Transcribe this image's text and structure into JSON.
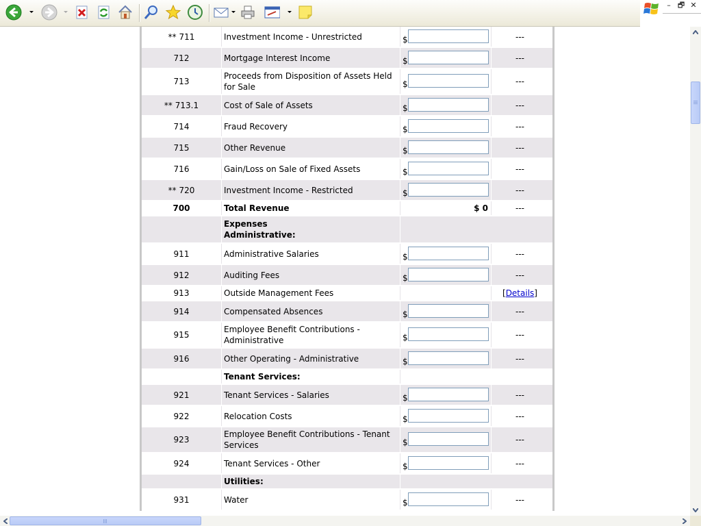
{
  "window": {
    "minimize_glyph": "–",
    "restore_glyph": "🗗",
    "close_glyph": "✕"
  },
  "toolbar": {
    "buttons": [
      {
        "name": "back-icon",
        "has_dropdown": true
      },
      {
        "name": "forward-icon",
        "has_dropdown": true
      },
      {
        "name": "stop-icon"
      },
      {
        "name": "refresh-icon"
      },
      {
        "name": "home-icon"
      },
      {
        "name": "search-icon"
      },
      {
        "name": "favorites-icon"
      },
      {
        "name": "history-icon"
      },
      {
        "name": "mail-icon",
        "has_dropdown": true
      },
      {
        "name": "print-icon"
      },
      {
        "name": "edit-icon",
        "has_dropdown": true
      },
      {
        "name": "note-icon"
      }
    ]
  },
  "form": {
    "currency_symbol": "$",
    "placeholder_status": "---",
    "rows": [
      {
        "code": "** 711",
        "desc": "Investment Income - Unrestricted",
        "kind": "input",
        "shade": false,
        "status": "---"
      },
      {
        "code": "712",
        "desc": "Mortgage Interest Income",
        "kind": "input",
        "shade": true,
        "status": "---"
      },
      {
        "code": "713",
        "desc": "Proceeds from Disposition of Assets Held for Sale",
        "kind": "input",
        "shade": false,
        "status": "---"
      },
      {
        "code": "** 713.1",
        "desc": "Cost of Sale of Assets",
        "kind": "input",
        "shade": true,
        "status": "---"
      },
      {
        "code": "714",
        "desc": "Fraud Recovery",
        "kind": "input",
        "shade": false,
        "status": "---"
      },
      {
        "code": "715",
        "desc": "Other Revenue",
        "kind": "input",
        "shade": true,
        "status": "---"
      },
      {
        "code": "716",
        "desc": "Gain/Loss on Sale of Fixed Assets",
        "kind": "input",
        "shade": false,
        "status": "---"
      },
      {
        "code": "** 720",
        "desc": "Investment Income - Restricted",
        "kind": "input",
        "shade": true,
        "status": "---"
      },
      {
        "code": "700",
        "desc": "Total Revenue",
        "kind": "total",
        "shade": false,
        "amount": "$ 0",
        "status": "---"
      },
      {
        "code": "",
        "desc": "Expenses\nAdministrative:",
        "kind": "section",
        "shade": true
      },
      {
        "code": "911",
        "desc": "Administrative Salaries",
        "kind": "input",
        "shade": false,
        "status": "---"
      },
      {
        "code": "912",
        "desc": "Auditing Fees",
        "kind": "input",
        "shade": true,
        "status": "---"
      },
      {
        "code": "913",
        "desc": "Outside Management Fees",
        "kind": "link",
        "shade": false,
        "link_label": "Details"
      },
      {
        "code": "914",
        "desc": "Compensated Absences",
        "kind": "input",
        "shade": true,
        "status": "---"
      },
      {
        "code": "915",
        "desc": "Employee Benefit Contributions - Administrative",
        "kind": "input",
        "shade": false,
        "status": "---"
      },
      {
        "code": "916",
        "desc": "Other Operating - Administrative",
        "kind": "input",
        "shade": true,
        "status": "---"
      },
      {
        "code": "",
        "desc": "Tenant Services:",
        "kind": "section",
        "shade": false
      },
      {
        "code": "921",
        "desc": "Tenant Services - Salaries",
        "kind": "input",
        "shade": true,
        "status": "---"
      },
      {
        "code": "922",
        "desc": "Relocation Costs",
        "kind": "input",
        "shade": false,
        "status": "---"
      },
      {
        "code": "923",
        "desc": "Employee Benefit Contributions - Tenant Services",
        "kind": "input",
        "shade": true,
        "status": "---"
      },
      {
        "code": "924",
        "desc": "Tenant Services - Other",
        "kind": "input",
        "shade": false,
        "status": "---"
      },
      {
        "code": "",
        "desc": "Utilities:",
        "kind": "section",
        "shade": true
      },
      {
        "code": "931",
        "desc": "Water",
        "kind": "input",
        "shade": false,
        "status": "---"
      }
    ]
  },
  "colors": {
    "row_shade": "#e9e6ea",
    "input_border": "#7f9db9",
    "link": "#0000cc",
    "scroll_thumb": "#c8d6fb"
  }
}
